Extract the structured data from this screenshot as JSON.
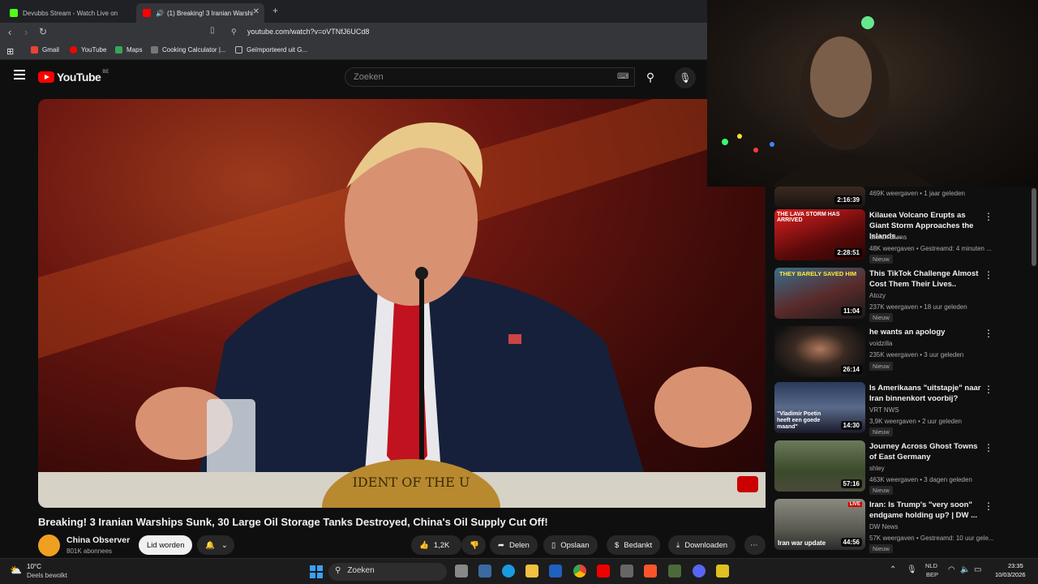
{
  "browser": {
    "tabs": [
      {
        "title": "Devubbs Stream - Watch Live on",
        "active": false
      },
      {
        "title": "(1) Breaking! 3 Iranian Warshi",
        "active": true
      }
    ],
    "new_tab": "+",
    "url": "youtube.com/watch?v=oVTNfJ6UCd8",
    "bookmarks": [
      "Gmail",
      "YouTube",
      "Maps",
      "Cooking Calculator |...",
      "Geïmporteerd uit G..."
    ]
  },
  "youtube": {
    "logo_text": "YouTube",
    "logo_region": "BE",
    "search_placeholder": "Zoeken"
  },
  "video": {
    "title": "Breaking! 3 Iranian Warships Sunk, 30 Large Oil Storage Tanks Destroyed, China's Oil Supply Cut Off!",
    "channel": "China Observer",
    "subscribers": "801K abonnees",
    "join_label": "Lid worden",
    "likes": "1,2K",
    "share_label": "Delen",
    "save_label": "Opslaan",
    "thanks_label": "Bedankt",
    "download_label": "Downloaden",
    "seal_text": "IDENT OF THE U"
  },
  "related": [
    {
      "title": "",
      "channel": "",
      "meta": "469K weergaven • 1 jaar geleden",
      "duration": "2:16:39",
      "badge": ""
    },
    {
      "title": "Kilauea Volcano Erupts as Giant Storm Approaches the Islands...",
      "channel": "Stefan Burns",
      "meta": "48K weergaven • Gestreamd: 4 minuten ...",
      "duration": "2:28:51",
      "badge": "Nieuw",
      "thumb_text": "THE LAVA STORM HAS ARRIVED"
    },
    {
      "title": "This TikTok Challenge Almost Cost Them Their Lives..",
      "channel": "Atozy",
      "meta": "237K weergaven • 18 uur geleden",
      "duration": "11:04",
      "badge": "Nieuw",
      "thumb_text": "THEY BARELY SAVED HIM"
    },
    {
      "title": "he wants an apology",
      "channel": "voidzilla",
      "meta": "235K weergaven • 3 uur geleden",
      "duration": "26:14",
      "badge": "Nieuw"
    },
    {
      "title": "Is Amerikaans \"uitstapje\" naar Iran binnenkort voorbij?",
      "channel": "VRT NWS",
      "meta": "3,9K weergaven • 2 uur geleden",
      "duration": "14:30",
      "badge": "Nieuw",
      "thumb_text": "\"Vladimir Poetin heeft een goede maand\""
    },
    {
      "title": "Journey Across Ghost Towns of East Germany",
      "channel": "shley",
      "meta": "463K weergaven • 3 dagen geleden",
      "duration": "57:16",
      "badge": "Nieuw"
    },
    {
      "title": "Iran: Is Trump's \"very soon\" endgame holding up? | DW ...",
      "channel": "DW News",
      "meta": "57K weergaven • Gestreamd: 10 uur gele...",
      "duration": "44:56",
      "badge": "Nieuw",
      "thumb_text": "Iran war update",
      "live": "LIVE"
    }
  ],
  "taskbar": {
    "temperature": "10°C",
    "weather": "Deels bewolkt",
    "search_placeholder": "Zoeken",
    "lang_top": "NLD",
    "lang_bottom": "BEP",
    "time": "23:35",
    "date": "10/03/2026"
  }
}
